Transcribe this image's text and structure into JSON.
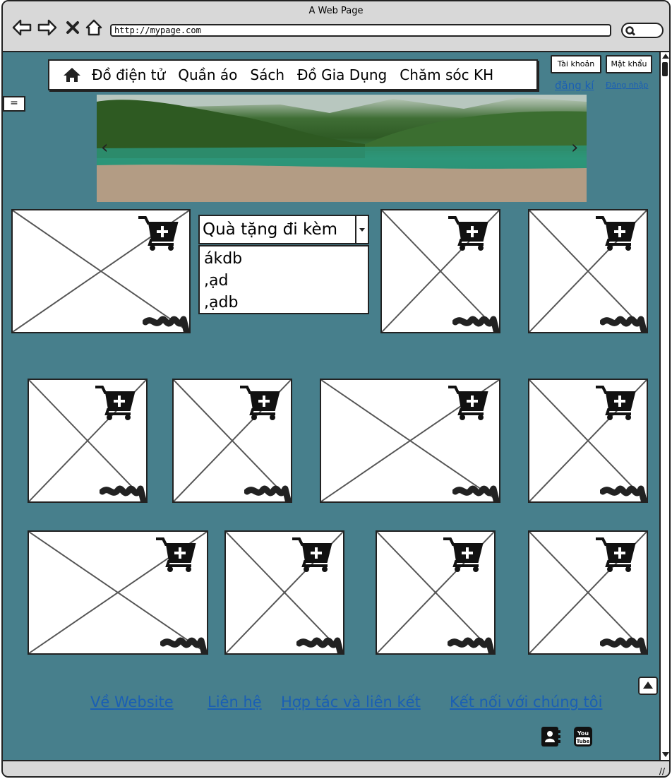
{
  "window": {
    "title": "A Web Page",
    "url": "http://mypage.com"
  },
  "nav": {
    "items": [
      "Đồ điện tử",
      "Quần áo",
      "Sách",
      "Đồ Gia Dụng",
      "Chăm sóc KH"
    ]
  },
  "account": {
    "username_label": "Tài khoản",
    "password_label": "Mật khẩu",
    "register_link": "đăng kí",
    "login_link": "Đăng nhập"
  },
  "sidebar_toggle": "=",
  "gift": {
    "selected": "Quà tặng đi kèm",
    "options": [
      "ákdb",
      ",ạd",
      ",ạdb"
    ]
  },
  "footer": {
    "links": [
      "Về Website",
      "Liên hệ",
      "Hợp tác và liên kết",
      "Kết nối với chúng tôi"
    ],
    "social": [
      "contact-book-icon",
      "youtube-icon"
    ],
    "youtube_text": "You Tube"
  },
  "colors": {
    "page_bg": "#477f8c",
    "link": "#1a5fb4"
  }
}
